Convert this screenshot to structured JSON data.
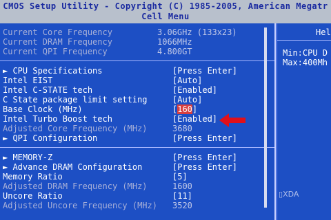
{
  "title": {
    "line1": "CMOS Setup Utility - Copyright (C) 1985-2005, American Megatr",
    "line2": "Cell Menu"
  },
  "info_rows": [
    {
      "label": "Current Core Frequency",
      "value": "3.06GHz (133x23)"
    },
    {
      "label": "Current DRAM Frequency",
      "value": "1066MHz"
    },
    {
      "label": "Current QPI Frequency",
      "value": "4.800GT"
    }
  ],
  "settings_group1": [
    {
      "label": "► CPU Specifications",
      "value": "[Press Enter]",
      "style": "item"
    },
    {
      "label": "Intel EIST",
      "value": "[Auto]",
      "style": "item"
    },
    {
      "label": "Intel C-STATE tech",
      "value": "[Enabled]",
      "style": "item"
    },
    {
      "label": "C State package limit setting",
      "value": "[Auto]",
      "style": "item"
    },
    {
      "label": "Base Clock (MHz)",
      "value_prefix": "[",
      "value_highlight": "160",
      "value_suffix": "]",
      "style": "item"
    },
    {
      "label": "Intel Turbo Boost tech",
      "value": "[Enabled]",
      "style": "item"
    },
    {
      "label": "Adjusted Core Frequency (MHz)",
      "value": "3680",
      "style": "dim"
    },
    {
      "label": "► QPI Configuration",
      "value": "[Press Enter]",
      "style": "item"
    }
  ],
  "settings_group2": [
    {
      "label": "► MEMORY-Z",
      "value": "[Press Enter]",
      "style": "item"
    },
    {
      "label": "► Advance DRAM Configuration",
      "value": "[Press Enter]",
      "style": "item"
    },
    {
      "label": "Memory Ratio",
      "value": "[5]",
      "style": "item"
    },
    {
      "label": "Adjusted DRAM Frequency (MHz)",
      "value": "1600",
      "style": "dim"
    },
    {
      "label": "Uncore Ratio",
      "value": "[11]",
      "style": "item"
    },
    {
      "label": "Adjusted Uncore Frequency (MHz)",
      "value": "3520",
      "style": "dim"
    }
  ],
  "help": {
    "title": "Hel",
    "lines": [
      "Min:CPU D",
      "Max:400Mh"
    ]
  },
  "watermark": "XDA",
  "colors": {
    "background": "#1d4fc4",
    "titlebar": "#b8c0cc",
    "highlight": "#d94040",
    "arrow": "#e0101a"
  }
}
